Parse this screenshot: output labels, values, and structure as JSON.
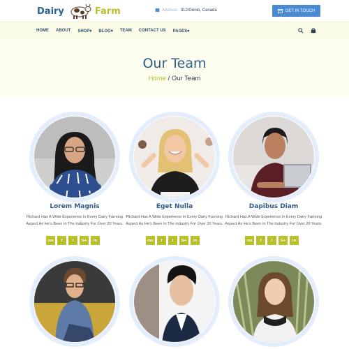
{
  "brand": {
    "word1": "Dairy",
    "word2": "Farm"
  },
  "header": {
    "address_label": "Address:",
    "address_value": "312/Gonio, Canada",
    "cta_label": "GET IN TOUCH"
  },
  "nav": {
    "items": [
      "HOME",
      "ABOUT",
      "SHOP",
      "BLOG",
      "TEAM",
      "CONTACT US",
      "PAGES"
    ]
  },
  "hero": {
    "title": "Our Team",
    "crumb_home": "Home",
    "crumb_sep": " / ",
    "crumb_current": "Our Team"
  },
  "team": [
    {
      "name": "Lorem Magnis",
      "bio": "Richard Has A Wide Experience In Every Dairy Farming Aspect As He's Been In The Industry For Over 20 Years."
    },
    {
      "name": "Eget Nulla",
      "bio": "Richard Has A Wide Experience In Every Dairy Farming Aspect As He's Been In The Industry For Over 20 Years."
    },
    {
      "name": "Dapibus Diam",
      "bio": "Richard Has A Wide Experience In Every Dairy Farming Aspect As He's Been In The Industry For Over 20 Years."
    }
  ],
  "social": [
    "rss",
    "f",
    "t",
    "G+",
    "in"
  ],
  "colors": {
    "accent": "#b7c22b",
    "primary": "#2f5d89",
    "button": "#4a8ad3",
    "ring": "#e3edfb"
  },
  "icons": [
    "cow-logo-icon",
    "map-pin-icon",
    "envelope-icon",
    "search-icon",
    "cart-icon"
  ]
}
